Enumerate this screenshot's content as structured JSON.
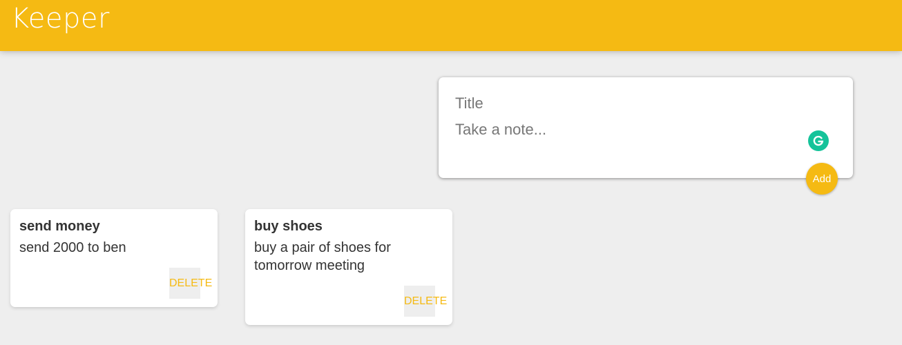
{
  "header": {
    "title": "Keeper"
  },
  "create_note": {
    "title_placeholder": "Title",
    "content_placeholder": "Take a note...",
    "title_value": "",
    "content_value": "",
    "add_label": "Add",
    "grammarly_icon": "grammarly-icon"
  },
  "notes": [
    {
      "title": "send money",
      "content": "send 2000 to ben",
      "delete_label": "DELETE"
    },
    {
      "title": "buy shoes",
      "content": "buy a pair of shoes for tomorrow meeting",
      "delete_label": "DELETE"
    }
  ],
  "colors": {
    "accent": "#f5ba13",
    "background": "#eeeeee",
    "card": "#ffffff",
    "grammarly": "#15c39a"
  }
}
